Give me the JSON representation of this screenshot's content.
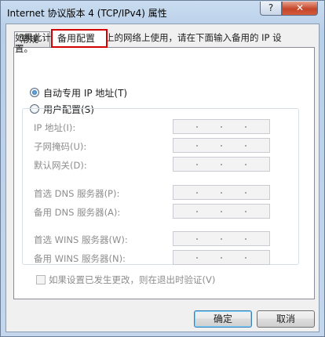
{
  "window": {
    "title": "Internet 协议版本 4 (TCP/IPv4) 属性",
    "help_label": "?",
    "close_label": "✕"
  },
  "tabs": [
    {
      "label": "常规",
      "active": false
    },
    {
      "label": "备用配置",
      "active": true
    }
  ],
  "description": "如果此计算机在一个以上的网络上使用，请在下面输入备用的 IP 设置。",
  "options": {
    "auto_label": "自动专用 IP 地址(T)",
    "user_label": "用户配置(S)",
    "selected": "auto"
  },
  "fields": [
    {
      "label": "IP 地址(I):",
      "value": ""
    },
    {
      "label": "子网掩码(U):",
      "value": ""
    },
    {
      "label": "默认网关(D):",
      "value": ""
    },
    {
      "label": "首选 DNS 服务器(P):",
      "value": ""
    },
    {
      "label": "备用 DNS 服务器(A):",
      "value": ""
    },
    {
      "label": "首选 WINS 服务器(W):",
      "value": ""
    },
    {
      "label": "备用 WINS 服务器(N):",
      "value": ""
    }
  ],
  "validate": {
    "label": "如果设置已发生更改，则在退出时验证(V)",
    "checked": false
  },
  "buttons": {
    "ok": "确定",
    "cancel": "取消"
  },
  "colors": {
    "highlight_border": "#d40000",
    "disabled_text": "#8d8d8d"
  }
}
